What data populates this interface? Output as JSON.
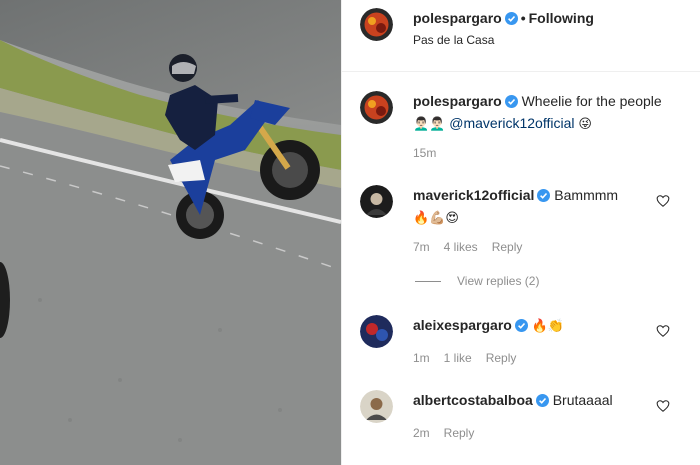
{
  "header": {
    "username": "polespargaro",
    "separator": "•",
    "follow_label": "Following",
    "location": "Pas de la Casa"
  },
  "caption": {
    "username": "polespargaro",
    "text": "Wheelie for the people",
    "emoji_line": "👨🏻‍🦱👨🏻‍🦱",
    "mention": "@maverick12official",
    "trailing_emoji": "😜",
    "time": "15m"
  },
  "comments": [
    {
      "username": "maverick12official",
      "text": "Bammmm",
      "emoji": "🔥💪🏼😍",
      "time": "7m",
      "likes": "4 likes",
      "reply": "Reply"
    },
    {
      "username": "aleixespargaro",
      "text": "",
      "emoji": "🔥👏",
      "time": "1m",
      "likes": "1 like",
      "reply": "Reply"
    },
    {
      "username": "albertcostabalboa",
      "text": "Brutaaaal",
      "emoji": "",
      "time": "2m",
      "likes": "",
      "reply": "Reply"
    }
  ],
  "view_replies": "View replies (2)",
  "colors": {
    "verified": "#3897f0",
    "secondary": "#8e8e8e",
    "text": "#262626"
  },
  "icons": [
    "verified-badge-icon",
    "heart-icon"
  ]
}
